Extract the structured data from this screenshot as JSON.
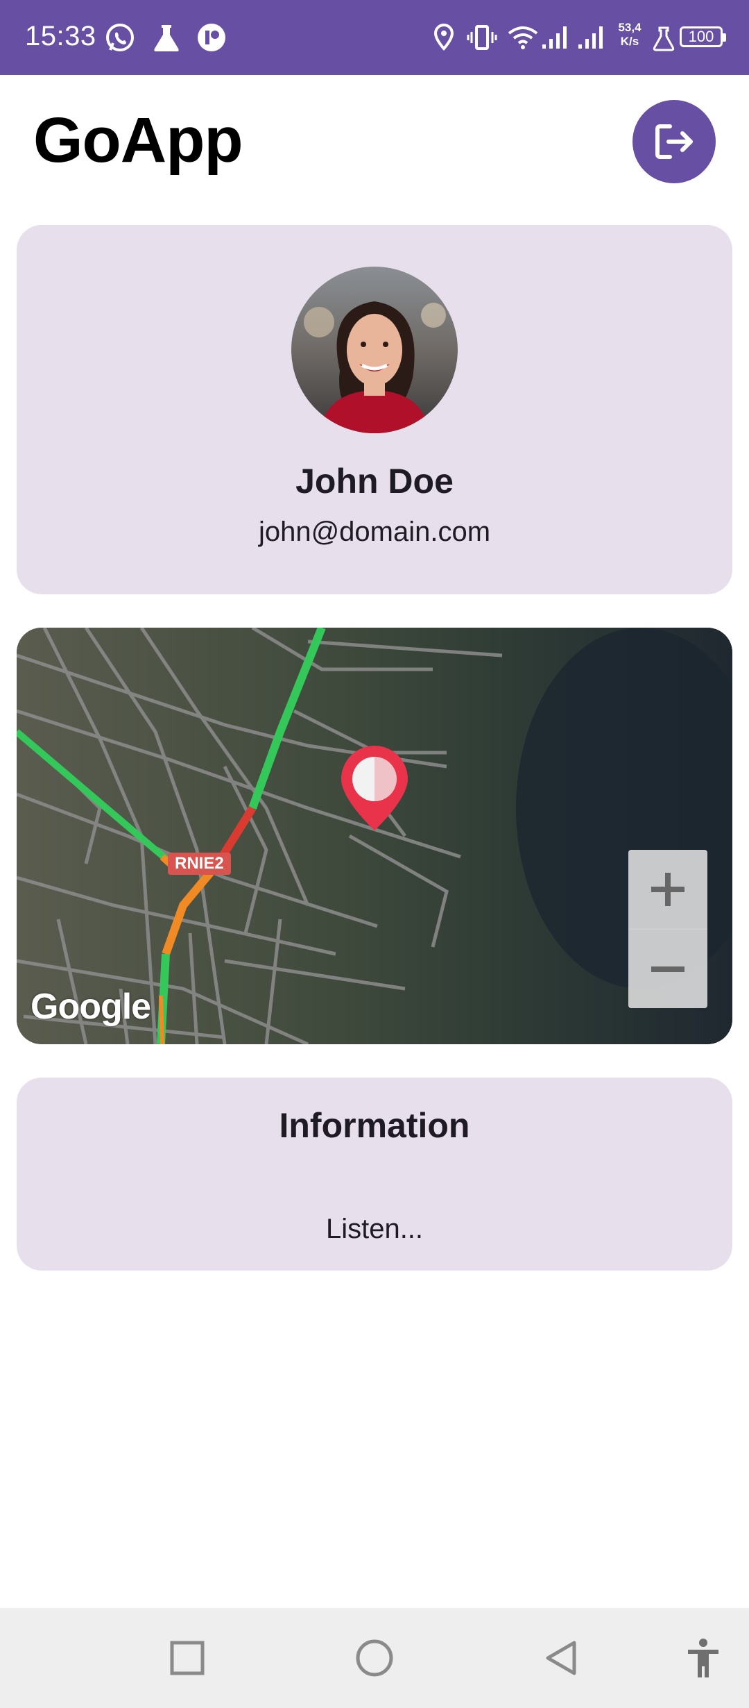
{
  "status_bar": {
    "time": "15:33",
    "net_speed_value": "53,4",
    "net_speed_unit": "K/s",
    "battery": "100",
    "icons": [
      "whatsapp-icon",
      "lab-flask-icon",
      "app-circle-icon",
      "location-icon",
      "vibrate-icon",
      "wifi-icon",
      "signal-icon",
      "signal-icon",
      "lab-flask-icon",
      "battery-icon"
    ]
  },
  "header": {
    "title": "GoApp",
    "logout_icon": "logout-icon"
  },
  "profile": {
    "name": "John Doe",
    "email": "john@domain.com"
  },
  "map": {
    "road_label": "RNIE2",
    "attribution": "Google",
    "zoom_in_label": "+",
    "zoom_out_label": "−"
  },
  "information": {
    "title": "Information",
    "text": "Listen..."
  },
  "nav": {
    "icons": [
      "recents-icon",
      "home-icon",
      "back-icon",
      "accessibility-icon"
    ]
  },
  "colors": {
    "primary": "#6750a4",
    "card_background": "#e7e0ec",
    "nav_background": "#eeeeee",
    "map_pin": "#e8334a"
  }
}
